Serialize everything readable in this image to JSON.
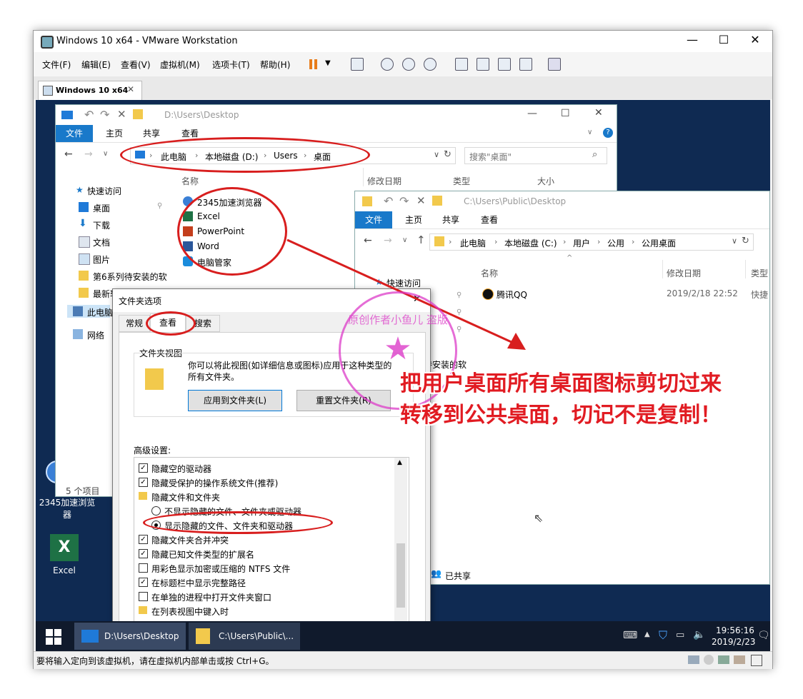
{
  "vm_window": {
    "title": "Windows 10 x64 - VMware Workstation",
    "tab": "Windows 10 x64",
    "menu": [
      "文件(F)",
      "编辑(E)",
      "查看(V)",
      "虚拟机(M)",
      "选项卡(T)",
      "帮助(H)"
    ],
    "status_text": "要将输入定向到该虚拟机，请在虚拟机内部单击或按 Ctrl+G。"
  },
  "explorer1": {
    "title": "D:\\Users\\Desktop",
    "ribbon_tabs": [
      "文件",
      "主页",
      "共享",
      "查看"
    ],
    "breadcrumb": [
      "此电脑",
      "本地磁盘 (D:)",
      "Users",
      "桌面"
    ],
    "search_placeholder": "搜索\"桌面\"",
    "columns": [
      "名称",
      "修改日期",
      "类型",
      "大小"
    ],
    "nav": [
      "快速访问",
      "桌面",
      "下载",
      "文档",
      "图片",
      "第6系列待安装的软",
      "最新软",
      "此电脑",
      "网络"
    ],
    "files": [
      "2345加速浏览器",
      "Excel",
      "PowerPoint",
      "Word",
      "电脑管家"
    ],
    "status": "5 个项目"
  },
  "explorer2": {
    "title": "C:\\Users\\Public\\Desktop",
    "ribbon_tabs": [
      "文件",
      "主页",
      "共享",
      "查看"
    ],
    "breadcrumb": [
      "此电脑",
      "本地磁盘 (C:)",
      "用户",
      "公用",
      "公用桌面"
    ],
    "columns": [
      "名称",
      "修改日期",
      "类型"
    ],
    "col_type_partial": "类型",
    "nav": [
      "快速访问"
    ],
    "file_name": "腾讯QQ",
    "file_date": "2019/2/18 22:52",
    "file_type_partial": "快捷",
    "partial_text": "待安装的软",
    "shared_label": "已共享"
  },
  "dialog": {
    "title": "文件夹选项",
    "tabs": [
      "常规",
      "查看",
      "搜索"
    ],
    "folder_view_group": "文件夹视图",
    "folder_view_desc": "你可以将此视图(如详细信息或图标)应用于这种类型的所有文件夹。",
    "apply_button": "应用到文件夹(L)",
    "reset_button": "重置文件夹(R)",
    "advanced_label": "高级设置:",
    "settings": [
      {
        "type": "check",
        "checked": true,
        "label": "隐藏空的驱动器"
      },
      {
        "type": "check",
        "checked": true,
        "label": "隐藏受保护的操作系统文件(推荐)"
      },
      {
        "type": "folder",
        "label": "隐藏文件和文件夹"
      },
      {
        "type": "radio",
        "checked": false,
        "label": "不显示隐藏的文件、文件夹或驱动器"
      },
      {
        "type": "radio",
        "checked": true,
        "label": "显示隐藏的文件、文件夹和驱动器"
      },
      {
        "type": "check",
        "checked": true,
        "label": "隐藏文件夹合并冲突"
      },
      {
        "type": "check",
        "checked": true,
        "label": "隐藏已知文件类型的扩展名"
      },
      {
        "type": "check",
        "checked": false,
        "label": "用彩色显示加密或压缩的 NTFS 文件"
      },
      {
        "type": "check",
        "checked": true,
        "label": "在标题栏中显示完整路径"
      },
      {
        "type": "check",
        "checked": false,
        "label": "在单独的进程中打开文件夹窗口"
      },
      {
        "type": "folder",
        "label": "在列表视图中键入时"
      }
    ]
  },
  "desktop_icons": [
    "2345加速浏览器",
    "Excel"
  ],
  "taskbar": {
    "items": [
      "D:\\Users\\Desktop",
      "C:\\Users\\Public\\..."
    ],
    "time": "19:56:16",
    "date": "2019/2/23"
  },
  "annotation": {
    "line1": "把用户桌面所有桌面图标剪切过来",
    "line2": "转移到公共桌面，切记不是复制！",
    "color": "#e11b22"
  },
  "watermark": {
    "text": "原创作者小鱼儿 盗版"
  }
}
